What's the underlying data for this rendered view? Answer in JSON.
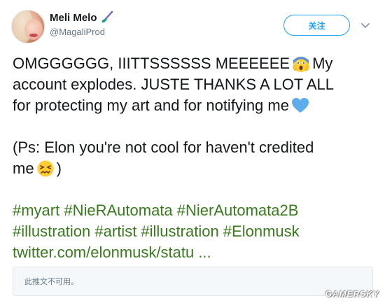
{
  "author": {
    "name": "Meli Melo",
    "handle": "@MagaliProd",
    "name_icon": "paintbrush-icon"
  },
  "actions": {
    "follow_label": "关注",
    "menu_icon": "chevron-down-icon"
  },
  "tweet": {
    "lines": [
      {
        "text": "OMGGGGGG, IIITTSSSSSS MEEEEEE",
        "after": "My",
        "emoji": "screaming-face-icon"
      },
      {
        "text": "account explodes. JUSTE THANKS A LOT ALL"
      },
      {
        "text": "for protecting my art and for notifying me",
        "emoji": "blue-heart-icon"
      },
      {
        "text": ""
      },
      {
        "text": "(Ps: Elon you're not cool for haven't credited"
      },
      {
        "text": "me",
        "emoji": "confounded-face-icon",
        "after": ")"
      }
    ],
    "hashtag_lines": [
      "#myart #NieRAutomata #NierAutomata2B",
      "#illustration #artist #illustration #Elonmusk",
      "twitter.com/elonmusk/statu ..."
    ]
  },
  "card": {
    "unavailable_text": "此推文不可用。"
  },
  "watermark": "GAMERSKY",
  "colors": {
    "accent": "#1da1f2",
    "hashtag": "#3a7a1f",
    "text": "#14171a",
    "muted": "#657786"
  }
}
